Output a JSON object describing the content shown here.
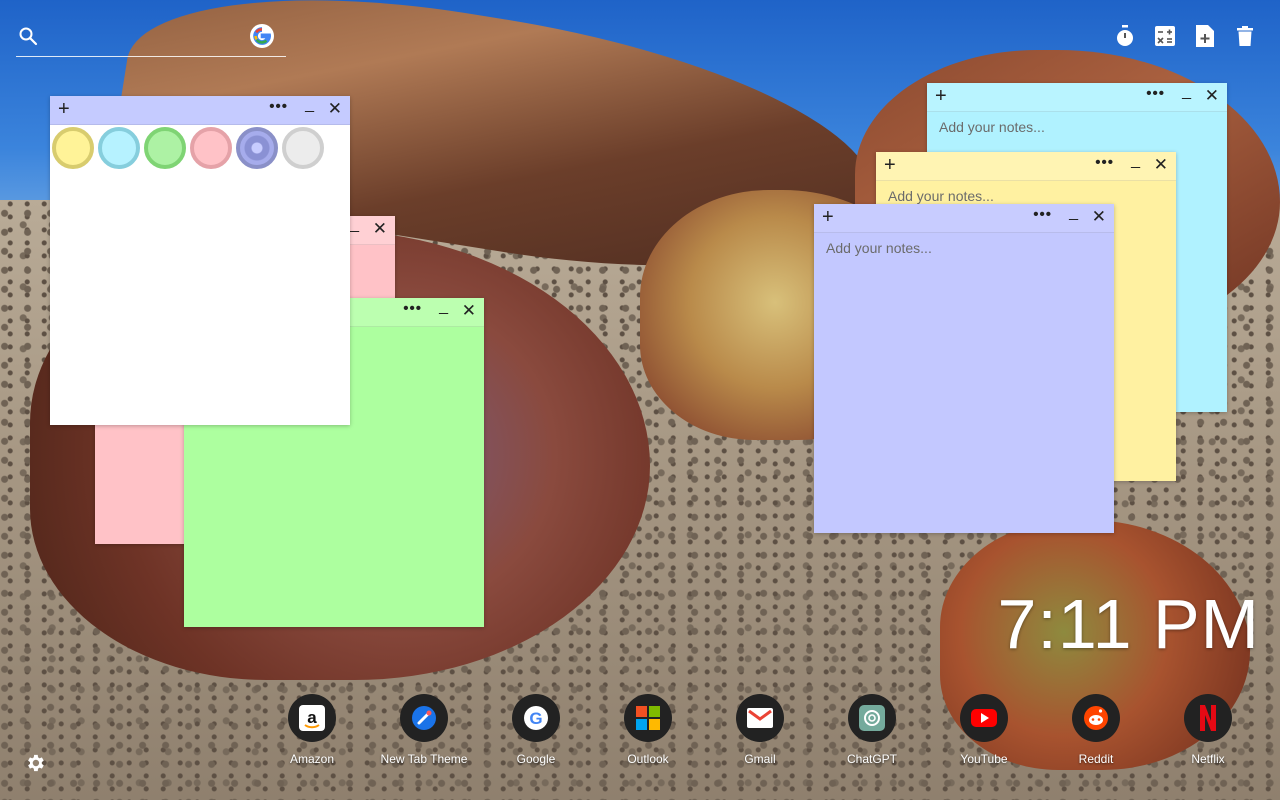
{
  "search": {
    "placeholder": ""
  },
  "toolbar": {
    "icons": [
      "timer-icon",
      "calculator-icon",
      "new-note-icon",
      "trash-icon"
    ]
  },
  "notes": {
    "placeholder": "Add your notes...",
    "add_label": "+",
    "more_label": "•••",
    "minimize_label": "_",
    "close_label": "✕",
    "colors": {
      "white": "#ffffff",
      "pink": "#ffc2c7",
      "green": "#adff9f",
      "cyan": "#b0f2ff",
      "yellow": "#fff1a1",
      "blue": "#c3c8ff",
      "header_blue": "#c5cbff"
    },
    "color_picker": [
      "yellow",
      "cyan",
      "green",
      "pink",
      "blue",
      "gray"
    ]
  },
  "clock": {
    "time": "7:11 PM"
  },
  "shortcuts": [
    {
      "label": "Amazon",
      "icon": "amazon-icon"
    },
    {
      "label": "New Tab Theme",
      "icon": "new-tab-theme-icon"
    },
    {
      "label": "Google",
      "icon": "google-icon"
    },
    {
      "label": "Outlook",
      "icon": "outlook-icon"
    },
    {
      "label": "Gmail",
      "icon": "gmail-icon"
    },
    {
      "label": "ChatGPT",
      "icon": "chatgpt-icon"
    },
    {
      "label": "YouTube",
      "icon": "youtube-icon"
    },
    {
      "label": "Reddit",
      "icon": "reddit-icon"
    },
    {
      "label": "Netflix",
      "icon": "netflix-icon"
    }
  ],
  "settings": {
    "icon": "gear-icon"
  }
}
